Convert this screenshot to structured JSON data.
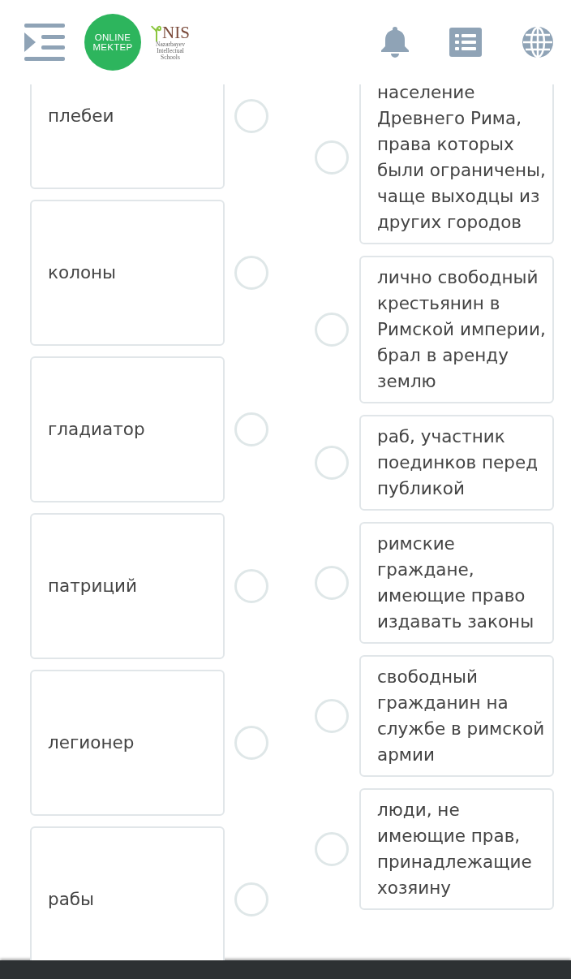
{
  "header": {
    "logo": {
      "line_1": "ONLINE",
      "line_2": "MEKTEP"
    },
    "partner_logo": {
      "name": "NIS",
      "subtitle": [
        "Nazarbayev",
        "Intellectual",
        "Schools"
      ]
    }
  },
  "terms": [
    {
      "text": "плебеи",
      "selected": false
    },
    {
      "text": "колоны",
      "selected": false
    },
    {
      "text": "гладиатор",
      "selected": false
    },
    {
      "text": "патриций",
      "selected": false
    },
    {
      "text": "легионер",
      "selected": false
    },
    {
      "text": "рабы",
      "selected": false
    }
  ],
  "definitions": [
    {
      "text": "население Древнего Рима, права которых были ограничены, чаще выходцы из других городов",
      "selected": false
    },
    {
      "text": "лично свободный крестьянин в Римской империи, брал в аренду землю",
      "selected": false
    },
    {
      "text": "раб, участник поединков перед публикой",
      "selected": false
    },
    {
      "text": "римские граждане, имеющие право издавать законы",
      "selected": false
    },
    {
      "text": "свободный гражданин на службе в римской армии",
      "selected": false
    },
    {
      "text": "люди, не имеющие прав, принадлежащие хозяину",
      "selected": false
    }
  ]
}
